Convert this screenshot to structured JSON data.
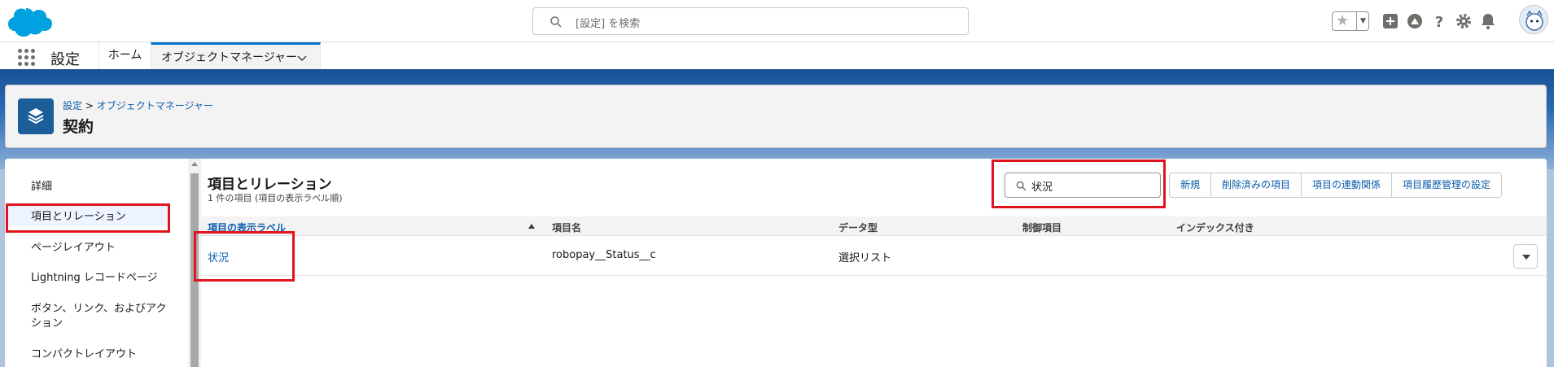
{
  "global_search": {
    "placeholder": "[設定] を検索"
  },
  "app": {
    "name": "設定"
  },
  "nav": {
    "home": "ホーム",
    "active_tab": "オブジェクトマネージャー"
  },
  "page": {
    "breadcrumb_root": "設定",
    "breadcrumb_sep": " > ",
    "breadcrumb_current": "オブジェクトマネージャー",
    "title": "契約"
  },
  "sidebar": {
    "items": [
      "詳細",
      "項目とリレーション",
      "ページレイアウト",
      "Lightning レコードページ",
      "ボタン、リンク、およびアクション",
      "コンパクトレイアウト"
    ]
  },
  "section": {
    "title": "項目とリレーション",
    "subtitle": "1 件の項目 (項目の表示ラベル順)",
    "quick_find_value": "状況",
    "buttons": [
      "新規",
      "削除済みの項目",
      "項目の連動関係",
      "項目履歴管理の設定"
    ]
  },
  "table": {
    "columns": [
      "項目の表示ラベル",
      "項目名",
      "データ型",
      "制御項目",
      "インデックス付き"
    ],
    "rows": [
      {
        "label": "状況",
        "api_name": "robopay__Status__c",
        "data_type": "選択リスト",
        "controlling": "",
        "indexed": ""
      }
    ]
  },
  "colors": {
    "brand": "#0176d3",
    "link": "#0b5cab",
    "highlight": "#e0141e",
    "header_band": "#1b5297"
  }
}
